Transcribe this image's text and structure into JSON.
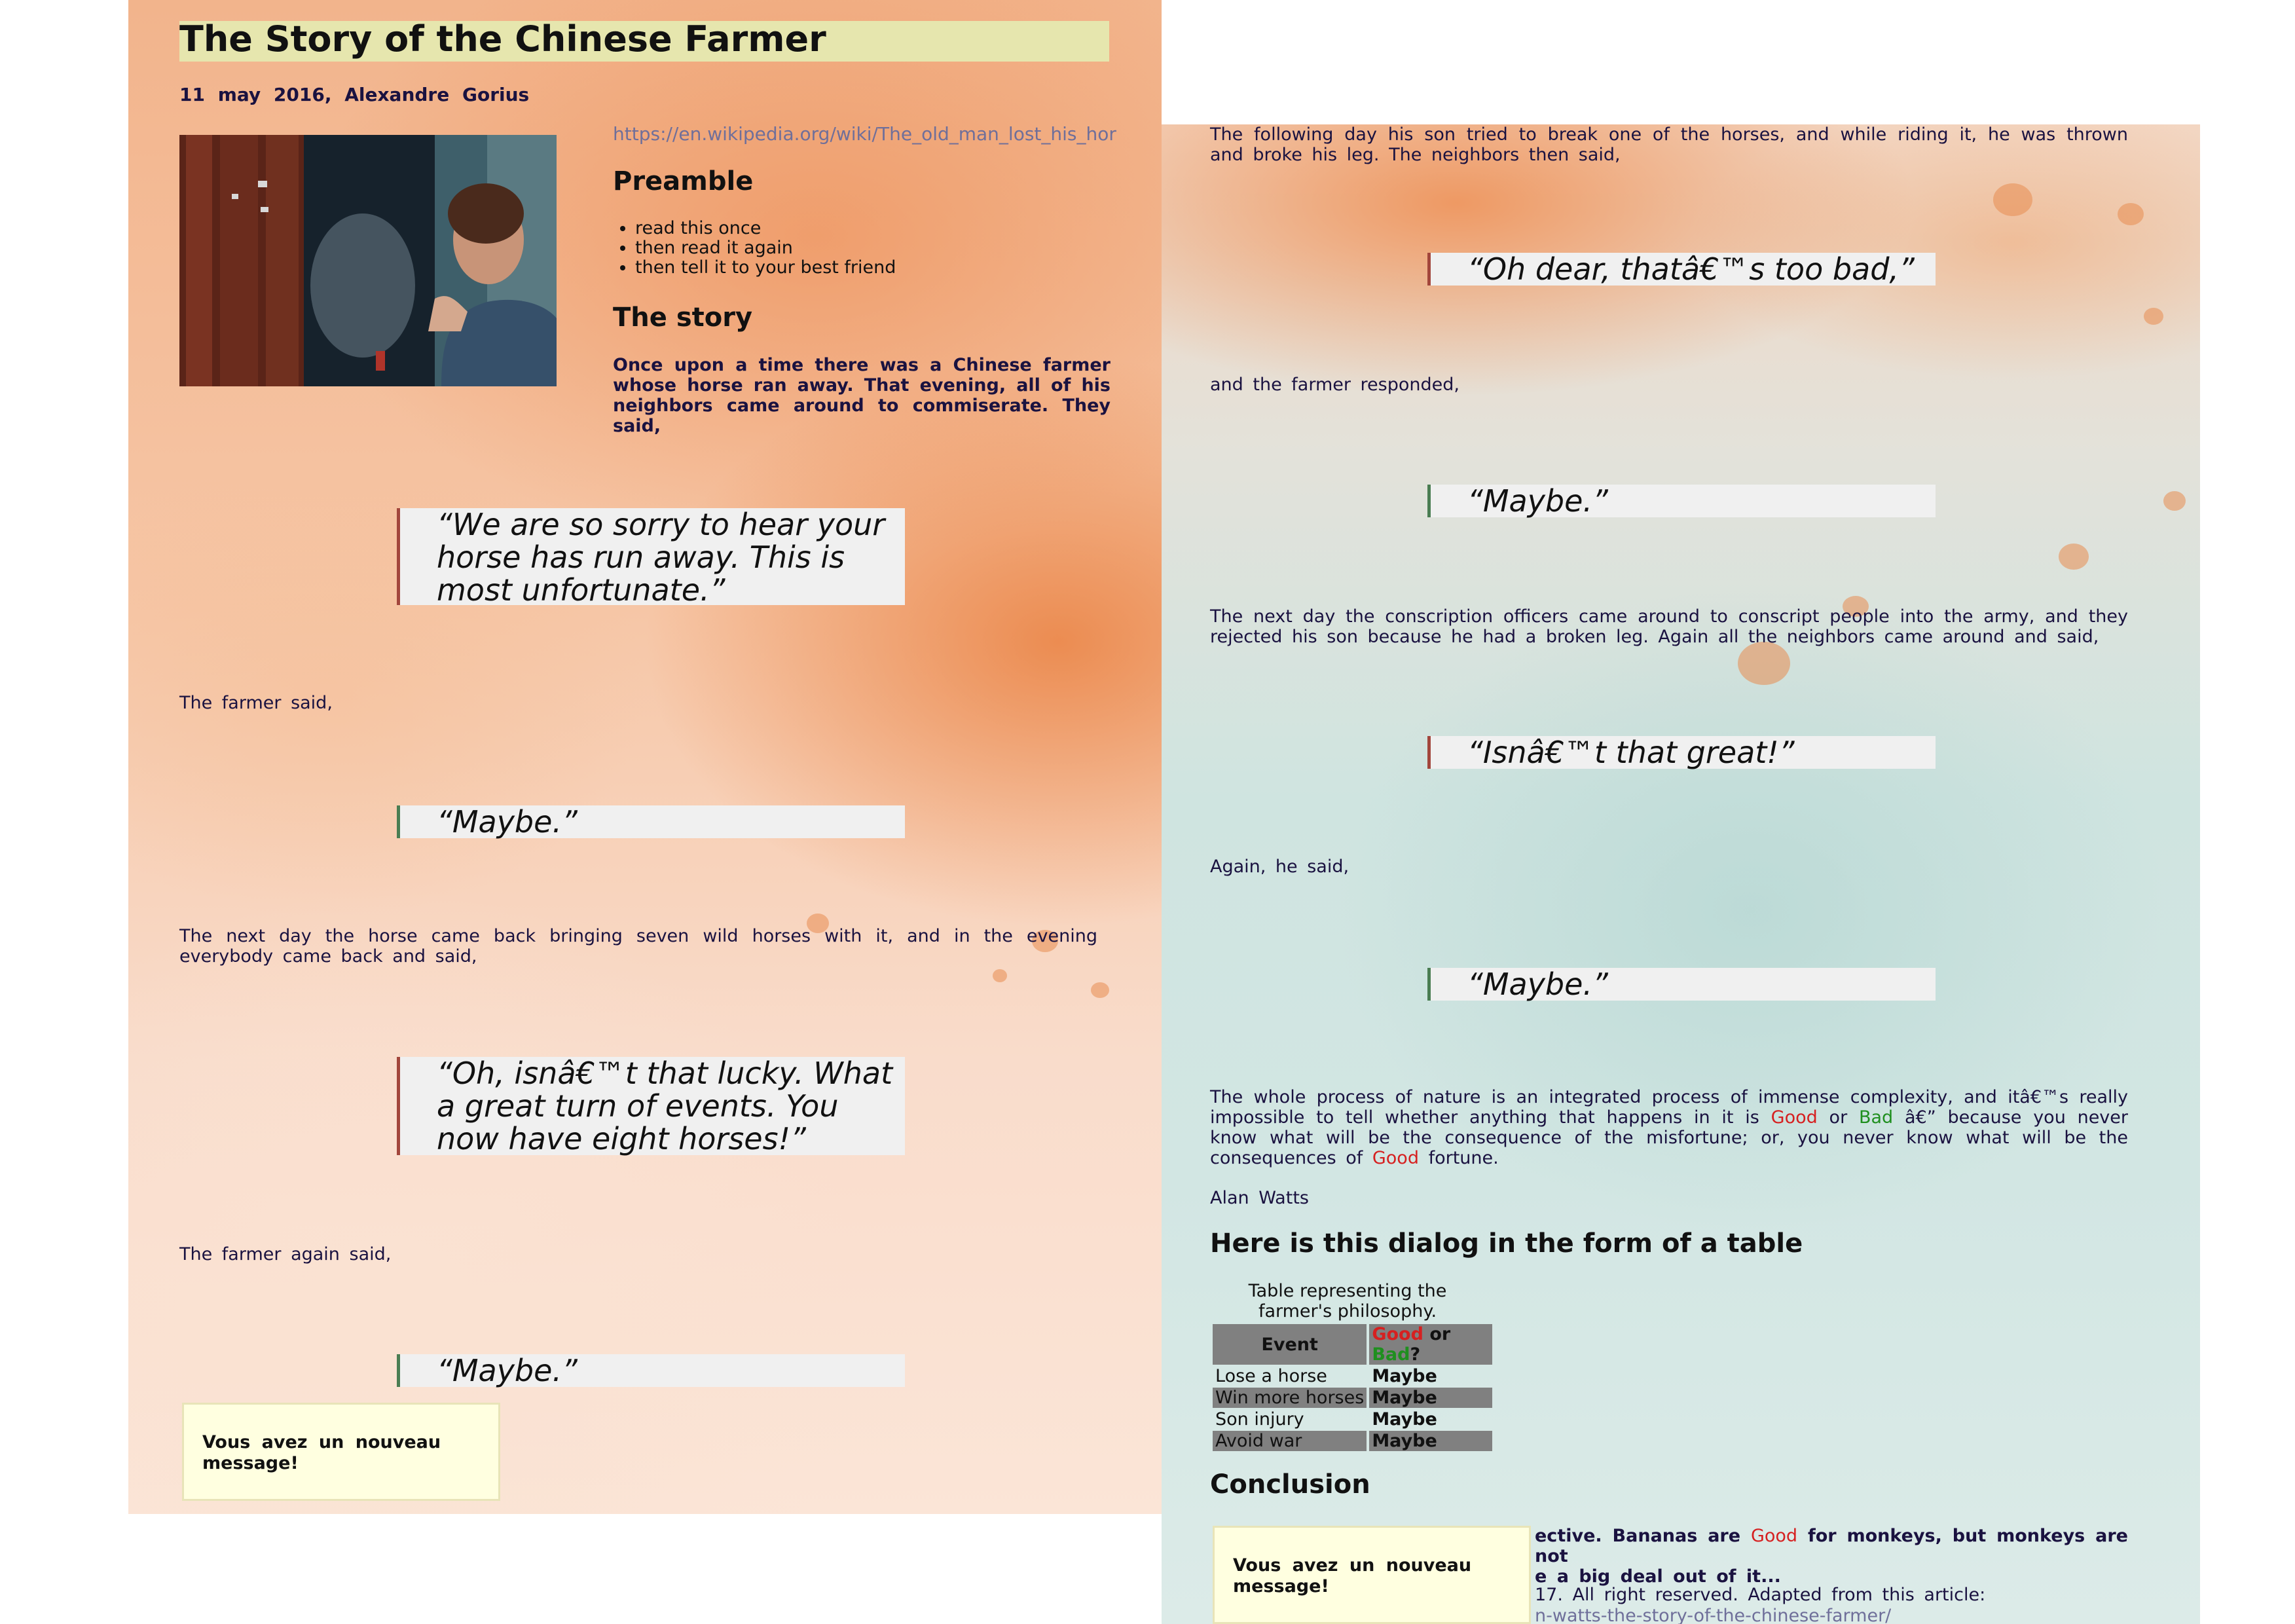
{
  "page1": {
    "title": "The Story of the Chinese Farmer",
    "byline": "11 may 2016, Alexandre Gorius",
    "source_link": "https://en.wikipedia.org/wiki/The_old_man_lost_his_horse tit",
    "preamble_heading": "Preamble",
    "preamble_items": [
      "read this once",
      "then read it again",
      "then tell it to your best friend"
    ],
    "story_heading": "The story",
    "intro": "Once upon a time there was a Chinese farmer whose horse ran away. That evening, all of his neighbors came around to commiserate. They said,",
    "quote1": "“We are so sorry to hear your horse has run away. This is most unfortunate.”",
    "farmer_said": "The farmer said,",
    "quote2": "“Maybe.”",
    "next_day": "The next day the horse came back bringing seven wild horses with it, and in the evening everybody came back and said,",
    "quote3": "“Oh, isnâ€™t that lucky. What a great turn of events. You now have eight horses!”",
    "farmer_again": "The farmer again said,",
    "quote4": "“Maybe.”",
    "toast": "Vous avez un nouveau message!"
  },
  "page2": {
    "following_day": "The following day his son tried to break one of the horses, and while riding it, he was thrown and broke his leg. The neighbors then said,",
    "quote5": "“Oh dear, thatâ€™s too bad,”",
    "farmer_responded": "and the farmer responded,",
    "quote6": "“Maybe.”",
    "conscription": "The next day the conscription officers came around to conscript people into the army, and they rejected his son because he had a broken leg. Again all the neighbors came around and said,",
    "quote7": "“Isnâ€™t that great!”",
    "again_said": "Again, he said,",
    "quote8": "“Maybe.”",
    "watts_1": "The whole process of nature is an integrated process of immense complexity, and itâ€™s really impossible to tell whether anything that happens in it is",
    "watts_good1": "Good",
    "watts_or": "or",
    "watts_bad": "Bad",
    "watts_2": "â€” because you never know what will be the consequence of the misfortune; or, you never know what will be the consequences of",
    "watts_good2": "Good",
    "watts_3": "fortune.",
    "author": "Alan Watts",
    "table_heading": "Here is this dialog in the form of a table",
    "table": {
      "caption": "Table representing the farmer's philosophy.",
      "header_event": "Event",
      "header_good": "Good",
      "header_or": "or",
      "header_bad": "Bad",
      "header_q": "?",
      "rows": [
        {
          "event": "Lose a horse",
          "verdict": "Maybe"
        },
        {
          "event": "Win more horses",
          "verdict": "Maybe"
        },
        {
          "event": "Son injury",
          "verdict": "Maybe"
        },
        {
          "event": "Avoid war",
          "verdict": "Maybe"
        }
      ]
    },
    "conclusion_heading": "Conclusion",
    "conclusion_a": "ective. Bananas are",
    "conclusion_good": "Good",
    "conclusion_b": "for monkeys, but monkeys are not",
    "conclusion_c": "e a big deal out of it...",
    "copyright": "17. All right reserved. Adapted from this article:",
    "article_link": "n-watts-the-story-of-the-chinese-farmer/",
    "toast": "Vous avez un nouveau message!"
  }
}
